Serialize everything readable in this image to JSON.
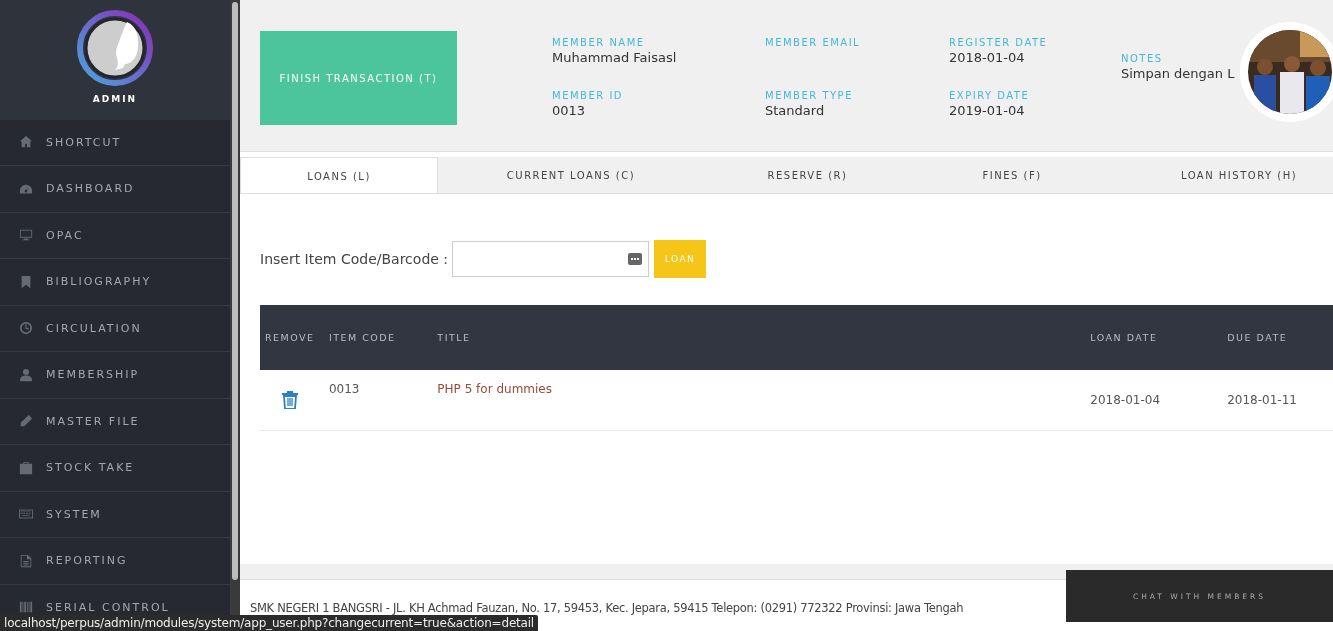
{
  "sidebar": {
    "user_name": "ADMIN",
    "items": [
      {
        "label": "SHORTCUT"
      },
      {
        "label": "DASHBOARD"
      },
      {
        "label": "OPAC"
      },
      {
        "label": "BIBLIOGRAPHY"
      },
      {
        "label": "CIRCULATION"
      },
      {
        "label": "MEMBERSHIP"
      },
      {
        "label": "MASTER FILE"
      },
      {
        "label": "STOCK TAKE"
      },
      {
        "label": "SYSTEM"
      },
      {
        "label": "REPORTING"
      },
      {
        "label": "SERIAL CONTROL"
      }
    ]
  },
  "member": {
    "finish_button": "FINISH TRANSACTION (T)",
    "columns": [
      [
        {
          "label": "MEMBER NAME",
          "value": "Muhammad Faisasl"
        },
        {
          "label": "MEMBER ID",
          "value": "0013"
        }
      ],
      [
        {
          "label": "MEMBER EMAIL"
        },
        {
          "label": "MEMBER TYPE",
          "value": "Standard"
        }
      ],
      [
        {
          "label": "REGISTER DATE",
          "value": "2018-01-04"
        },
        {
          "label": "EXPIRY DATE",
          "value": "2019-01-04"
        }
      ],
      [
        {
          "label": "NOTES",
          "value": "Simpan dengan L"
        }
      ]
    ]
  },
  "tabs": [
    {
      "label": "LOANS (L)",
      "selected": true
    },
    {
      "label": "CURRENT LOANS (C)",
      "selected": false
    },
    {
      "label": "RESERVE (R)",
      "selected": false
    },
    {
      "label": "FINES (F)",
      "selected": false
    },
    {
      "label": "LOAN HISTORY (H)",
      "selected": false
    }
  ],
  "loan_form": {
    "label": "Insert Item Code/Barcode :",
    "button": "LOAN"
  },
  "table": {
    "columns": [
      "REMOVE",
      "ITEM CODE",
      "TITLE",
      "LOAN DATE",
      "DUE DATE"
    ],
    "rows": [
      {
        "item_code": "0013",
        "title": "PHP 5 for dummies",
        "loan_date": "2018-01-04",
        "due_date": "2018-01-11"
      }
    ]
  },
  "footer": "SMK NEGERI 1 BANGSRI - JL. KH Achmad Fauzan, No. 17, 59453, Kec. Jepara, 59415 Telepon: (0291) 772322 Provinsi: Jawa Tengah",
  "chat": "CHAT WITH MEMBERS",
  "status_bar": "localhost/perpus/admin/modules/system/app_user.php?changecurrent=true&action=detail"
}
